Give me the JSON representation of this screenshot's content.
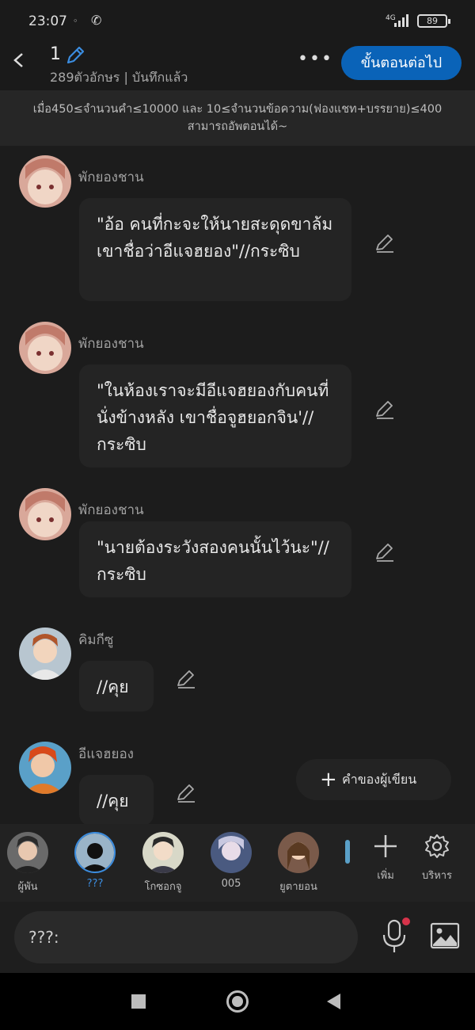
{
  "status": {
    "time": "23:07",
    "network": "4G",
    "battery": "89"
  },
  "header": {
    "title": "1",
    "subtitle": "289ตัวอักษร | บันทึกแล้ว",
    "next_label": "ขั้นตอนต่อไป"
  },
  "notice": {
    "line1": "เมื่อ450≤จำนวนคำ≤10000 และ 10≤จำนวนข้อความ(ฟองแชท+บรรยาย)≤400",
    "line2": "สามารถอัพตอนได้~"
  },
  "messages": [
    {
      "speaker": "พักยองชาน",
      "text": "\"อ้อ คนที่กะจะให้นายสะดุดขาล้มเขาชื่อว่าอีแจฮยอง\"//กระซิบ"
    },
    {
      "speaker": "พักยองชาน",
      "text": "\"ในห้องเราจะมีอีแจฮยองกับคนที่นั่งข้างหลัง เขาชื่อจูฮยอกจิน'//กระซิบ"
    },
    {
      "speaker": "พักยองชาน",
      "text": "\"นายต้องระวังสองคนนั้นไว้นะ\"//กระซิบ"
    },
    {
      "speaker": "คิมกีซู",
      "text": "//คุย"
    },
    {
      "speaker": "อีแจฮยอง",
      "text": "//คุย"
    }
  ],
  "author_words_label": "คำของผู้เขียน",
  "characters": [
    {
      "name": "ผู้พัน"
    },
    {
      "name": "???"
    },
    {
      "name": "โกซอกจู"
    },
    {
      "name": "005"
    },
    {
      "name": "ยูตายอน"
    }
  ],
  "tools": {
    "add_label": "เพิ่ม",
    "manage_label": "บริหาร"
  },
  "input": {
    "prefix": "???:"
  },
  "colors": {
    "accent": "#0a63b8",
    "selected": "#3b8de0",
    "background": "#1c1c1c"
  }
}
